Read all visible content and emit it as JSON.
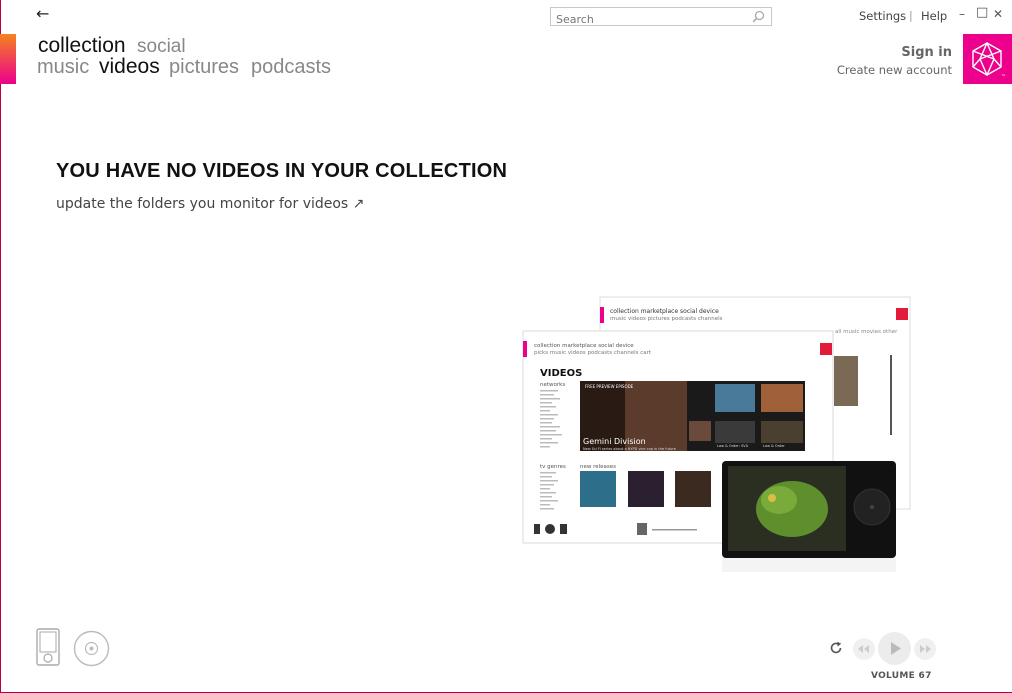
{
  "header": {
    "back_label": "←",
    "search": {
      "placeholder": "Search"
    },
    "settings_label": "Settings",
    "separator": "|",
    "help_label": "Help",
    "minimize_label": "–",
    "maximize_label": "□",
    "close_label": "✕",
    "pivots": [
      {
        "label": "collection",
        "active": true
      },
      {
        "label": "social",
        "active": false
      }
    ],
    "subpivots": [
      {
        "label": "music",
        "active": false
      },
      {
        "label": "videos",
        "active": true
      },
      {
        "label": "pictures",
        "active": false
      },
      {
        "label": "podcasts",
        "active": false
      }
    ],
    "sign_in_label": "Sign in",
    "create_account_label": "Create new account"
  },
  "main": {
    "headline": "YOU HAVE NO VIDEOS IN YOUR COLLECTION",
    "link_text": "update the folders you monitor for videos ↗",
    "illustration": {
      "front_window": {
        "nav_top": "collection   marketplace   social   device",
        "nav_bottom": "picks   music   videos   podcasts   channels   cart",
        "title": "VIDEOS",
        "side_heading": "networks",
        "genres_heading": "tv genres",
        "releases_heading": "new releases",
        "feature_tag": "FREE PREVIEW EPISODE",
        "feature_title": "Gemini Division",
        "feature_sub": "New Sci Fi series about a NYPD vice cop in the future",
        "tile_labels": [
          "Law & Order: SVU",
          "Law & Order"
        ]
      },
      "back_window": {
        "nav_top": "collection   marketplace   social   device",
        "nav_bottom": "music   videos   pictures   podcasts   channels",
        "filters": "all   music   movies   other"
      }
    }
  },
  "footer": {
    "volume_label": "VOLUME 67"
  },
  "colors": {
    "accent_pink": "#ec008c",
    "accent_orange": "#f58220",
    "nav_active": "#111111",
    "nav_inactive": "#888888"
  }
}
